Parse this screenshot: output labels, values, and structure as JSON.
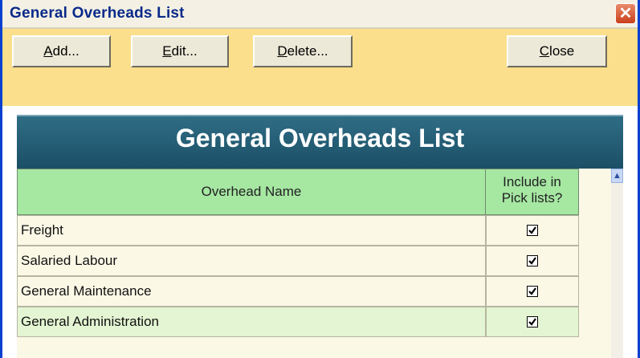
{
  "window": {
    "title": "General Overheads List",
    "close_glyph": "✕"
  },
  "toolbar": {
    "add_prefix": "",
    "add_mn": "A",
    "add_rest": "dd...",
    "edit_prefix": "",
    "edit_mn": "E",
    "edit_rest": "dit...",
    "delete_prefix": "",
    "delete_mn": "D",
    "delete_rest": "elete...",
    "close_prefix": "",
    "close_mn": "C",
    "close_rest": "lose"
  },
  "header": {
    "title": "General Overheads List"
  },
  "table": {
    "columns": [
      {
        "label": "Overhead Name"
      },
      {
        "label_line1": "Include in",
        "label_line2": "Pick lists?"
      }
    ],
    "rows": [
      {
        "name": "Freight",
        "include": true
      },
      {
        "name": "Salaried Labour",
        "include": true
      },
      {
        "name": "General Maintenance",
        "include": true
      },
      {
        "name": "General Administration",
        "include": true
      }
    ]
  },
  "colors": {
    "toolbar_bg": "#fbdf8c",
    "header_bg": "#1b4f66",
    "column_header_bg": "#a6e7a2",
    "grid_bg": "#fbf8e6",
    "selected_row_bg": "#e3f5d2"
  },
  "icons": {
    "close": "close-icon",
    "scroll_up": "chevron-up-icon",
    "checkbox": "checkbox-checked-icon"
  }
}
